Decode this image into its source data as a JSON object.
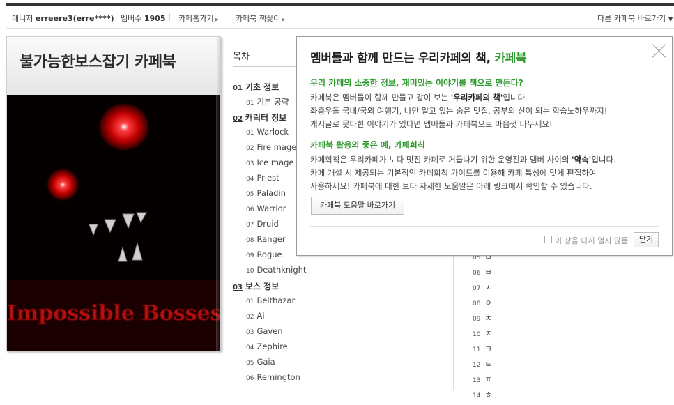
{
  "topbar": {
    "manager_label": "매니저",
    "manager_name": "erreere3(erre****)",
    "members_label": "멤버수",
    "members_count": "1905",
    "go_cafe": "카페홈가기",
    "bookmark": "카페북 책꽂이",
    "other_cafebook": "다른 카페북 바로가기"
  },
  "cover": {
    "title": "불가능한보스잡기 카페북",
    "art_text": "Impossible Bosses"
  },
  "toc": {
    "title": "목차",
    "sections": [
      {
        "num": "01",
        "label": "기초 정보",
        "items": [
          {
            "num": "01",
            "label": "기본 공략"
          }
        ]
      },
      {
        "num": "02",
        "label": "캐릭터 정보",
        "items": [
          {
            "num": "01",
            "label": "Warlock"
          },
          {
            "num": "02",
            "label": "Fire mage"
          },
          {
            "num": "03",
            "label": "Ice mage"
          },
          {
            "num": "04",
            "label": "Priest"
          },
          {
            "num": "05",
            "label": "Paladin"
          },
          {
            "num": "06",
            "label": "Warrior"
          },
          {
            "num": "07",
            "label": "Druid"
          },
          {
            "num": "08",
            "label": "Ranger"
          },
          {
            "num": "09",
            "label": "Rogue"
          },
          {
            "num": "10",
            "label": "Deathknight"
          }
        ]
      },
      {
        "num": "03",
        "label": "보스 정보",
        "items": [
          {
            "num": "01",
            "label": "Belthazar"
          },
          {
            "num": "02",
            "label": "Ai"
          },
          {
            "num": "03",
            "label": "Gaven"
          },
          {
            "num": "04",
            "label": "Zephire"
          },
          {
            "num": "05",
            "label": "Gaia"
          },
          {
            "num": "06",
            "label": "Remington"
          }
        ]
      }
    ],
    "right_items": [
      {
        "num": "05",
        "label": "ㅁ"
      },
      {
        "num": "06",
        "label": "ㅂ"
      },
      {
        "num": "07",
        "label": "ㅅ"
      },
      {
        "num": "08",
        "label": "ㅇ"
      },
      {
        "num": "09",
        "label": "ㅊ"
      },
      {
        "num": "10",
        "label": "ㅈ"
      },
      {
        "num": "11",
        "label": "ㅋ"
      },
      {
        "num": "12",
        "label": "ㅌ"
      },
      {
        "num": "13",
        "label": "ㅍ"
      },
      {
        "num": "14",
        "label": "ㅎ"
      }
    ]
  },
  "popup": {
    "title_main": "멤버들과 함께 만드는 우리카페의 책, ",
    "title_hl": "카페북",
    "head1": "우리 카페의 소중한 정보, 재미있는 이야기를 책으로 만든다?",
    "p1_line1_a": "카페북은 멤버들이 함께 만들고 같이 보는 ",
    "p1_line1_b": "'우리카페의 책'",
    "p1_line1_c": "입니다.",
    "p1_line2": "좌충우돌 국내/국외 여행기, 나만 알고 있는 숨은 맛집, 공부의 신이 되는 학습노하우까지!",
    "p1_line3": "게시글로 못다한 이야기가 있다면 멤버들과 카페북으로 마음껏 나누세요!",
    "head2": "카페북 활용의 좋은 예, 카페회칙",
    "p2_line1_a": "카페회칙은 우리카페가 보다 멋진 카페로 거듭나기 위한 운영진과 멤버 사이의 ",
    "p2_line1_b": "'약속'",
    "p2_line1_c": "입니다.",
    "p2_line2": "카페 개설 시 제공되는 기본적인 카페회칙 가이드를 이용해 카페 특성에 맞게 편집하여",
    "p2_line3": "사용하세요! 카페북에 대한 보다 자세한 도움말은 아래 링크에서 확인할 수 있습니다.",
    "help_button": "카페북 도움말 바로가기",
    "dont_show": "이 창을 다시 열지 않음",
    "close_button": "닫기"
  },
  "colors": {
    "accent_green": "#2e9a2e",
    "eye_red": "#e00000"
  }
}
